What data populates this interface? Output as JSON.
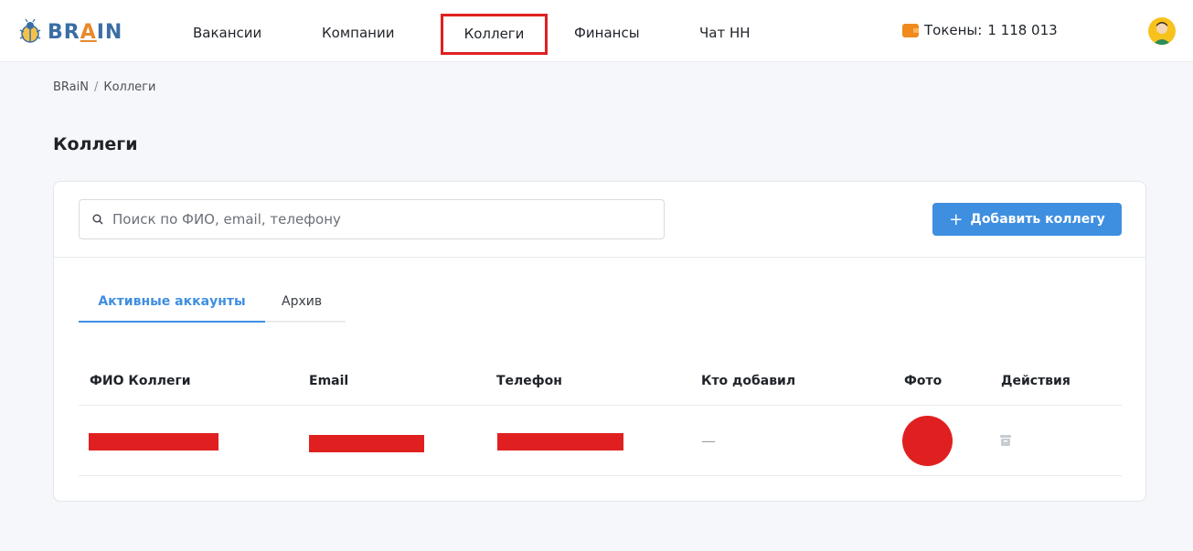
{
  "brand": {
    "name_prefix": "BR",
    "name_accent": "A",
    "name_suffix": "IN"
  },
  "nav": {
    "items": [
      {
        "label": "Вакансии"
      },
      {
        "label": "Компании"
      },
      {
        "label": "Коллеги"
      },
      {
        "label": "Финансы"
      },
      {
        "label": "Чат HH"
      }
    ],
    "active": "Коллеги"
  },
  "tokens": {
    "label": "Токены:",
    "value": "1 118 013"
  },
  "breadcrumb": {
    "root": "BRaiN",
    "separator": "/",
    "current": "Коллеги"
  },
  "page": {
    "title": "Коллеги"
  },
  "search": {
    "placeholder": "Поиск по ФИО, email, телефону",
    "value": ""
  },
  "actions": {
    "add_label": "Добавить коллегу"
  },
  "tabs": [
    {
      "label": "Активные аккаунты",
      "active": true
    },
    {
      "label": "Архив",
      "active": false
    }
  ],
  "table": {
    "columns": [
      "ФИО Коллеги",
      "Email",
      "Телефон",
      "Кто добавил",
      "Фото",
      "Действия"
    ],
    "rows": [
      {
        "name": "",
        "email": "",
        "phone": "",
        "added_by": "—",
        "photo": "",
        "action_icon": "archive-icon"
      }
    ]
  },
  "colors": {
    "accent": "#3f8fe0",
    "brand": "#3a6ea5",
    "highlight": "#e02020",
    "wallet": "#f08a1c"
  }
}
